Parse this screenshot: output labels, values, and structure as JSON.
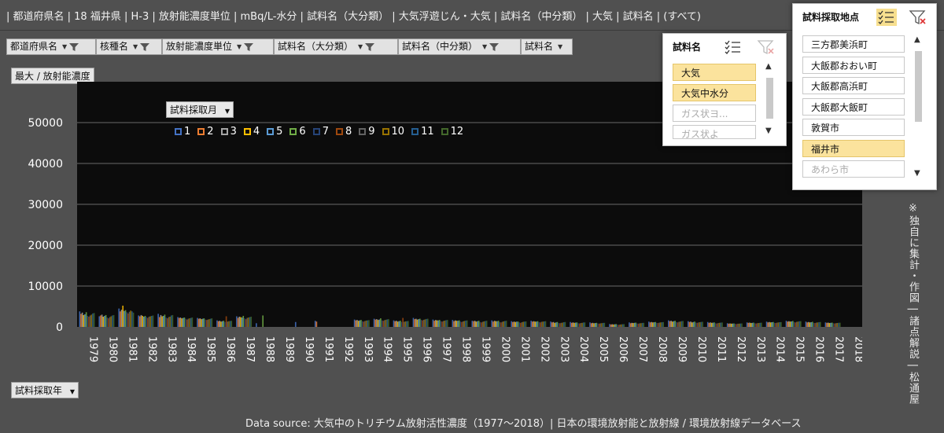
{
  "header": {
    "breadcrumb": "| 都道府県名 | 18 福井県 | H-3 | 放射能濃度単位 | mBq/L-水分 | 試料名（大分類） | 大気浮遊じん・大気 | 試料名（中分類） | 大気 | 試料名 | (すべて)"
  },
  "filters": [
    {
      "label": "都道府県名"
    },
    {
      "label": "核種名"
    },
    {
      "label": "放射能濃度単位"
    },
    {
      "label": "試料名（大分類）"
    },
    {
      "label": "試料名（中分類）"
    },
    {
      "label": "試料名"
    }
  ],
  "value_field": "最大 / 放射能濃度",
  "series_field": "試料採取月",
  "axis_field": "試料採取年",
  "vertical_note": "※独自に集計・作図 | 諸点解説 | 松通屋",
  "source_text": "Data source: 大気中のトリチウム放射活性濃度（1977～2018）| 日本の環境放射能と放射線 / 環境放射線データベース",
  "slicer_sample_name": {
    "title": "試料名",
    "items": [
      {
        "label": "大気",
        "state": "selected"
      },
      {
        "label": "大気中水分",
        "state": "selected"
      },
      {
        "label": "ガス状ヨ...",
        "state": "dim"
      },
      {
        "label": "ガス状よ",
        "state": "dim"
      }
    ]
  },
  "slicer_location": {
    "title": "試料採取地点",
    "items": [
      {
        "label": "三方郡美浜町",
        "state": "normal"
      },
      {
        "label": "大飯郡おおい町",
        "state": "normal"
      },
      {
        "label": "大飯郡高浜町",
        "state": "normal"
      },
      {
        "label": "大飯郡大飯町",
        "state": "normal"
      },
      {
        "label": "敦賀市",
        "state": "normal"
      },
      {
        "label": "福井市",
        "state": "selected"
      },
      {
        "label": "あわら市",
        "state": "dim"
      }
    ]
  },
  "colors": {
    "background": "#505050",
    "plot": "#0c0c0c",
    "selected": "#fbe39d"
  },
  "chart_data": {
    "type": "bar",
    "ylim": [
      0,
      60000
    ],
    "yticks": [
      0,
      10000,
      20000,
      30000,
      40000,
      50000
    ],
    "categories": [
      "1979",
      "1980",
      "1981",
      "1982",
      "1983",
      "1984",
      "1985",
      "1986",
      "1987",
      "1988",
      "1989",
      "1990",
      "1991",
      "1992",
      "1993",
      "1994",
      "1995",
      "1996",
      "1997",
      "1998",
      "1999",
      "2000",
      "2001",
      "2002",
      "2003",
      "2004",
      "2005",
      "2006",
      "2007",
      "2008",
      "2009",
      "2010",
      "2011",
      "2012",
      "2013",
      "2014",
      "2015",
      "2016",
      "2017",
      "2018"
    ],
    "series": [
      {
        "name": "1",
        "color": "#4472c4",
        "values": [
          3800,
          2600,
          4500,
          2800,
          3200,
          2400,
          2200,
          1600,
          2600,
          900,
          0,
          1200,
          1500,
          0,
          1800,
          2000,
          1600,
          2200,
          1800,
          1700,
          1500,
          1600,
          1400,
          1500,
          1300,
          1200,
          1100,
          700,
          1100,
          1300,
          1600,
          1400,
          1200,
          900,
          1100,
          1300,
          1500,
          1300,
          1100,
          0
        ]
      },
      {
        "name": "2",
        "color": "#ed7d31",
        "values": [
          3200,
          2800,
          3800,
          2600,
          2400,
          2200,
          2000,
          1400,
          2200,
          0,
          0,
          0,
          1300,
          0,
          1600,
          1800,
          1400,
          1900,
          1500,
          1400,
          1400,
          1300,
          1200,
          1300,
          1100,
          1000,
          900,
          600,
          900,
          1100,
          1400,
          1200,
          1000,
          800,
          1000,
          1100,
          1300,
          1100,
          1000,
          0
        ]
      },
      {
        "name": "3",
        "color": "#a5a5a5",
        "values": [
          3500,
          3000,
          4200,
          2900,
          2900,
          2300,
          2100,
          1500,
          2500,
          0,
          0,
          0,
          0,
          0,
          1700,
          1900,
          1500,
          2000,
          1700,
          1600,
          1500,
          1500,
          1300,
          1400,
          1200,
          1100,
          1000,
          650,
          1000,
          1200,
          1500,
          1300,
          1100,
          850,
          1050,
          1200,
          1400,
          1200,
          1050,
          0
        ]
      },
      {
        "name": "4",
        "color": "#ffc000",
        "values": [
          2900,
          2500,
          5200,
          2700,
          2600,
          2100,
          1900,
          1300,
          2400,
          0,
          0,
          0,
          0,
          0,
          1500,
          1700,
          1300,
          1800,
          1600,
          1500,
          1300,
          1400,
          1200,
          1300,
          1000,
          1000,
          900,
          600,
          950,
          1100,
          1300,
          1100,
          1000,
          800,
          950,
          1100,
          1300,
          1100,
          950,
          0
        ]
      },
      {
        "name": "5",
        "color": "#5b9bd5",
        "values": [
          3100,
          2700,
          3900,
          2500,
          2700,
          2200,
          2000,
          1400,
          2300,
          0,
          0,
          0,
          0,
          0,
          1600,
          1800,
          1400,
          1900,
          1600,
          1500,
          1400,
          1400,
          1300,
          1300,
          1100,
          1050,
          950,
          650,
          1000,
          1150,
          1400,
          1200,
          1050,
          820,
          1000,
          1150,
          1350,
          1150,
          1000,
          0
        ]
      },
      {
        "name": "6",
        "color": "#70ad47",
        "values": [
          3600,
          2900,
          4100,
          2700,
          3000,
          2300,
          2100,
          1500,
          2700,
          2800,
          0,
          0,
          0,
          0,
          1700,
          2100,
          1500,
          2000,
          1700,
          1600,
          1500,
          1500,
          1300,
          1400,
          1200,
          1100,
          1000,
          700,
          1050,
          1200,
          1500,
          1300,
          1100,
          850,
          1050,
          1200,
          1450,
          1250,
          1050,
          0
        ]
      },
      {
        "name": "7",
        "color": "#264478",
        "values": [
          2700,
          2300,
          3600,
          2400,
          2300,
          2000,
          1800,
          1200,
          2100,
          0,
          0,
          0,
          0,
          0,
          1400,
          1600,
          1200,
          1700,
          1400,
          1300,
          1200,
          1200,
          1100,
          1200,
          950,
          900,
          850,
          550,
          850,
          1000,
          1200,
          1050,
          900,
          750,
          900,
          1000,
          1200,
          1000,
          900,
          0
        ]
      },
      {
        "name": "8",
        "color": "#9e480e",
        "values": [
          2500,
          2100,
          3300,
          2200,
          2100,
          1800,
          1700,
          2600,
          1900,
          0,
          0,
          0,
          0,
          0,
          1300,
          1500,
          2200,
          1600,
          1300,
          1200,
          1100,
          1100,
          1000,
          1100,
          900,
          850,
          800,
          500,
          800,
          950,
          1100,
          1000,
          850,
          700,
          850,
          950,
          1100,
          950,
          850,
          0
        ]
      },
      {
        "name": "9",
        "color": "#636363",
        "values": [
          2800,
          2400,
          3700,
          2500,
          2400,
          2000,
          1800,
          1300,
          2200,
          0,
          0,
          0,
          0,
          0,
          1450,
          1650,
          1250,
          1750,
          1450,
          1350,
          1250,
          1250,
          1150,
          1250,
          1000,
          950,
          880,
          580,
          880,
          1050,
          1250,
          1100,
          950,
          780,
          920,
          1050,
          1250,
          1050,
          920,
          0
        ]
      },
      {
        "name": "10",
        "color": "#997300",
        "values": [
          3000,
          2600,
          4000,
          2600,
          2500,
          2100,
          1900,
          1400,
          2300,
          0,
          0,
          0,
          0,
          0,
          1550,
          1750,
          1350,
          1850,
          1550,
          1450,
          1350,
          1350,
          1250,
          1300,
          1050,
          1000,
          920,
          620,
          920,
          1100,
          1300,
          1150,
          1000,
          800,
          960,
          1100,
          1300,
          1100,
          960,
          0
        ]
      },
      {
        "name": "11",
        "color": "#255e91",
        "values": [
          3300,
          2800,
          3800,
          2700,
          2800,
          2200,
          2000,
          1450,
          2400,
          0,
          0,
          0,
          0,
          0,
          1600,
          1850,
          1400,
          1950,
          1650,
          1550,
          1450,
          1450,
          1300,
          1350,
          1150,
          1080,
          980,
          660,
          980,
          1150,
          1420,
          1220,
          1060,
          830,
          1010,
          1160,
          1380,
          1170,
          1010,
          0
        ]
      },
      {
        "name": "12",
        "color": "#43682b",
        "values": [
          3400,
          2900,
          3500,
          2800,
          2900,
          2300,
          2100,
          1500,
          2500,
          0,
          0,
          0,
          0,
          0,
          1650,
          1900,
          1450,
          2000,
          1700,
          1600,
          1500,
          1500,
          1350,
          1400,
          1200,
          1100,
          1000,
          680,
          1000,
          1180,
          1450,
          1250,
          1080,
          850,
          1030,
          1180,
          1400,
          1200,
          1030,
          0
        ]
      }
    ]
  }
}
